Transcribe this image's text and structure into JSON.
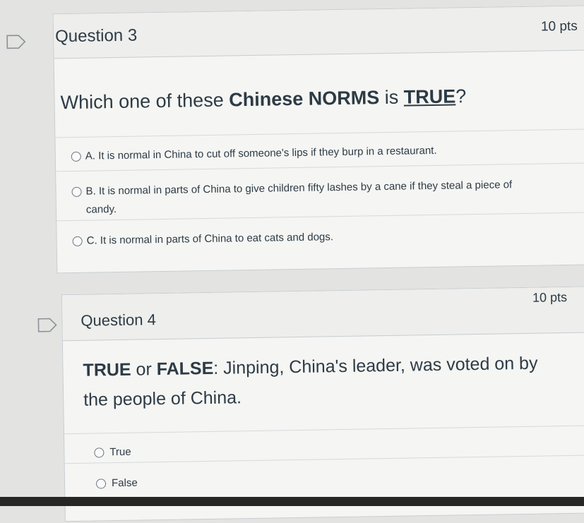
{
  "questions": [
    {
      "title": "Question 3",
      "points": "10 pts",
      "prompt_parts": [
        "Which one of these ",
        "Chinese NORMS",
        " is ",
        "TRUE",
        "?"
      ],
      "answers": [
        "A. It is normal in China to cut off someone's lips if they burp in a restaurant.",
        "B. It is normal in parts of China to give children fifty lashes by a cane if they steal a piece of candy.",
        "C. It is normal in parts of China to eat cats and dogs."
      ]
    },
    {
      "title": "Question 4",
      "points": "10 pts",
      "prompt_parts": [
        "TRUE",
        " or ",
        "FALSE",
        ": Jinping, China's leader, was voted on by the people of China."
      ],
      "answers": [
        "True",
        "False"
      ]
    }
  ],
  "colors": {
    "text": "#2d3b45",
    "border": "#c7cdd1",
    "background": "#e3e3e1"
  },
  "icons": {
    "bookmark": "bookmark-flag-icon",
    "radio": "radio-button-icon"
  }
}
